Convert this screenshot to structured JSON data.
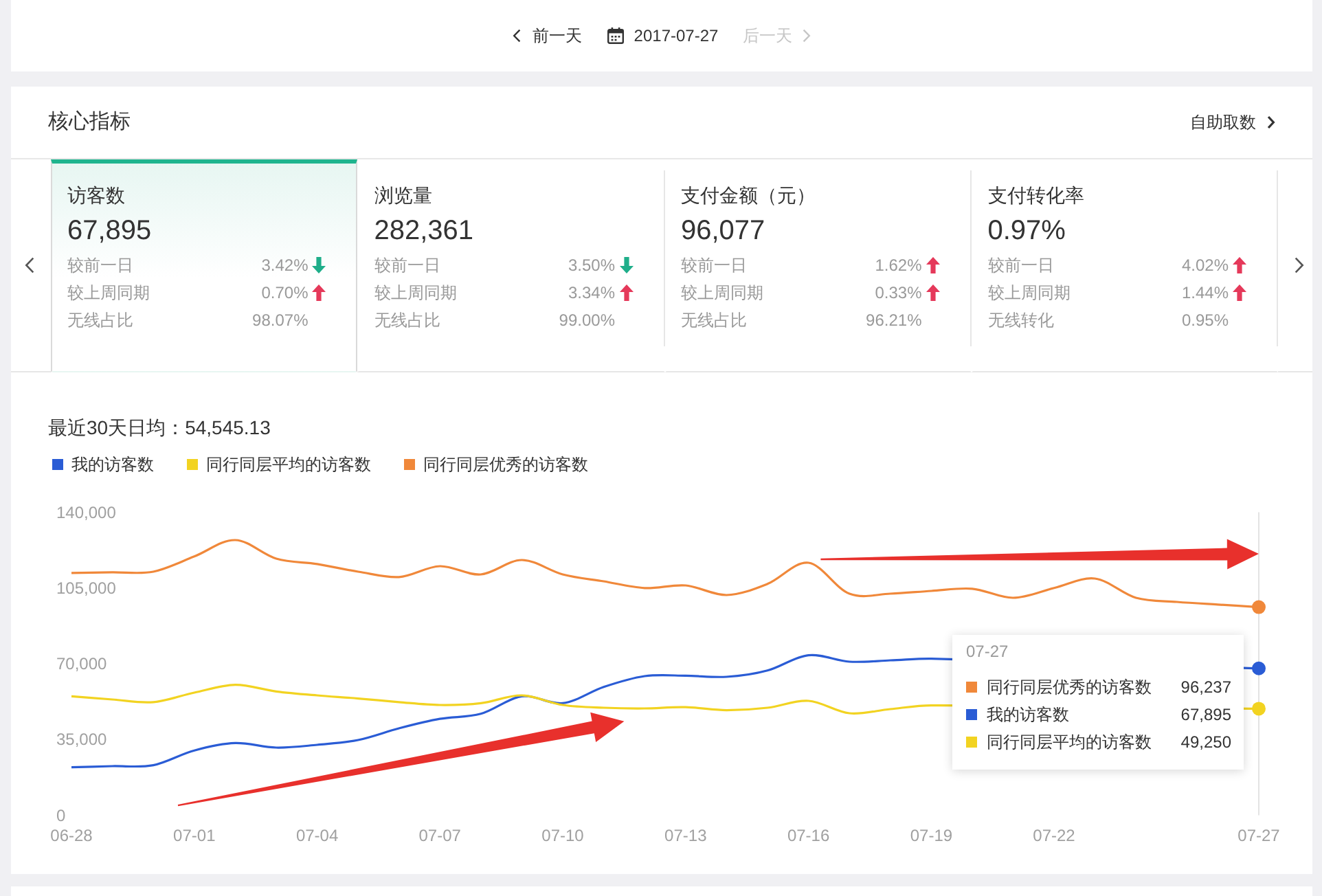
{
  "date_nav": {
    "prev": {
      "label": "前一天",
      "disabled": false
    },
    "date": "2017-07-27",
    "next": {
      "label": "后一天",
      "disabled": true
    }
  },
  "core_panel": {
    "title": "核心指标",
    "action": "自助取数",
    "metrics": [
      {
        "title": "访客数",
        "value": "67,895",
        "selected": true,
        "rows": [
          {
            "label": "较前一日",
            "value": "3.42%",
            "kind": "fall"
          },
          {
            "label": "较上周同期",
            "value": "0.70%",
            "kind": "rise"
          },
          {
            "label": "无线占比",
            "value": "98.07%",
            "kind": "plain"
          }
        ]
      },
      {
        "title": "浏览量",
        "value": "282,361",
        "selected": false,
        "rows": [
          {
            "label": "较前一日",
            "value": "3.50%",
            "kind": "fall"
          },
          {
            "label": "较上周同期",
            "value": "3.34%",
            "kind": "rise"
          },
          {
            "label": "无线占比",
            "value": "99.00%",
            "kind": "plain"
          }
        ]
      },
      {
        "title": "支付金额（元）",
        "value": "96,077",
        "selected": false,
        "rows": [
          {
            "label": "较前一日",
            "value": "1.62%",
            "kind": "rise"
          },
          {
            "label": "较上周同期",
            "value": "0.33%",
            "kind": "rise"
          },
          {
            "label": "无线占比",
            "value": "96.21%",
            "kind": "plain"
          }
        ]
      },
      {
        "title": "支付转化率",
        "value": "0.97%",
        "selected": false,
        "rows": [
          {
            "label": "较前一日",
            "value": "4.02%",
            "kind": "rise"
          },
          {
            "label": "较上周同期",
            "value": "1.44%",
            "kind": "rise"
          },
          {
            "label": "无线转化",
            "value": "0.95%",
            "kind": "plain"
          }
        ]
      }
    ],
    "trend": {
      "average": "最近30天日均：54,545.13",
      "chart_data": {
        "type": "line",
        "categories": [
          "06-28",
          null,
          null,
          "07-01",
          null,
          null,
          "07-04",
          null,
          null,
          "07-07",
          null,
          null,
          "07-10",
          null,
          null,
          "07-13",
          null,
          null,
          "07-16",
          null,
          null,
          "07-19",
          null,
          null,
          "07-22",
          null,
          null,
          null,
          null,
          "07-27"
        ],
        "ylim": [
          0,
          140000
        ],
        "yticks": [
          {
            "value": 0,
            "label": "0"
          },
          {
            "value": 35000,
            "label": "35,000"
          },
          {
            "value": 70000,
            "label": "70,000"
          },
          {
            "value": 105000,
            "label": "105,000"
          },
          {
            "value": 140000,
            "label": "140,000"
          }
        ],
        "series": [
          {
            "name": "我的访客数",
            "color": "#2a5cd5",
            "values": [
              22200,
              22700,
              23200,
              30000,
              33400,
              31300,
              32600,
              34800,
              40200,
              44600,
              46900,
              55000,
              51800,
              59300,
              64300,
              64500,
              64000,
              66900,
              74000,
              71000,
              71600,
              72400,
              null,
              null,
              null,
              null,
              null,
              null,
              null,
              67900
            ]
          },
          {
            "name": "同行同层平均的访客数",
            "color": "#f2d321",
            "values": [
              55000,
              53500,
              52300,
              56700,
              60300,
              57200,
              55400,
              54000,
              52300,
              51000,
              51800,
              55400,
              51000,
              49700,
              49400,
              50000,
              48600,
              49700,
              52900,
              47200,
              49100,
              50800,
              null,
              null,
              null,
              null,
              null,
              null,
              null,
              49300
            ]
          },
          {
            "name": "同行同层优秀的访客数",
            "color": "#f0883a",
            "values": [
              112000,
              112300,
              112600,
              119600,
              127200,
              118600,
              116100,
              112600,
              110100,
              115100,
              111300,
              118000,
              111300,
              108100,
              105000,
              106200,
              101800,
              106900,
              116700,
              102400,
              102400,
              103700,
              104700,
              100500,
              105000,
              109400,
              100500,
              98600,
              97400,
              96200
            ]
          }
        ]
      },
      "tooltip": {
        "title": "07-27",
        "rows": [
          {
            "label": "同行同层优秀的访客数",
            "value": "96,237",
            "color": "#f0883a"
          },
          {
            "label": "我的访客数",
            "value": "67,895",
            "color": "#2a5cd5"
          },
          {
            "label": "同行同层平均的访客数",
            "value": "49,250",
            "color": "#f2d321"
          }
        ]
      }
    }
  }
}
